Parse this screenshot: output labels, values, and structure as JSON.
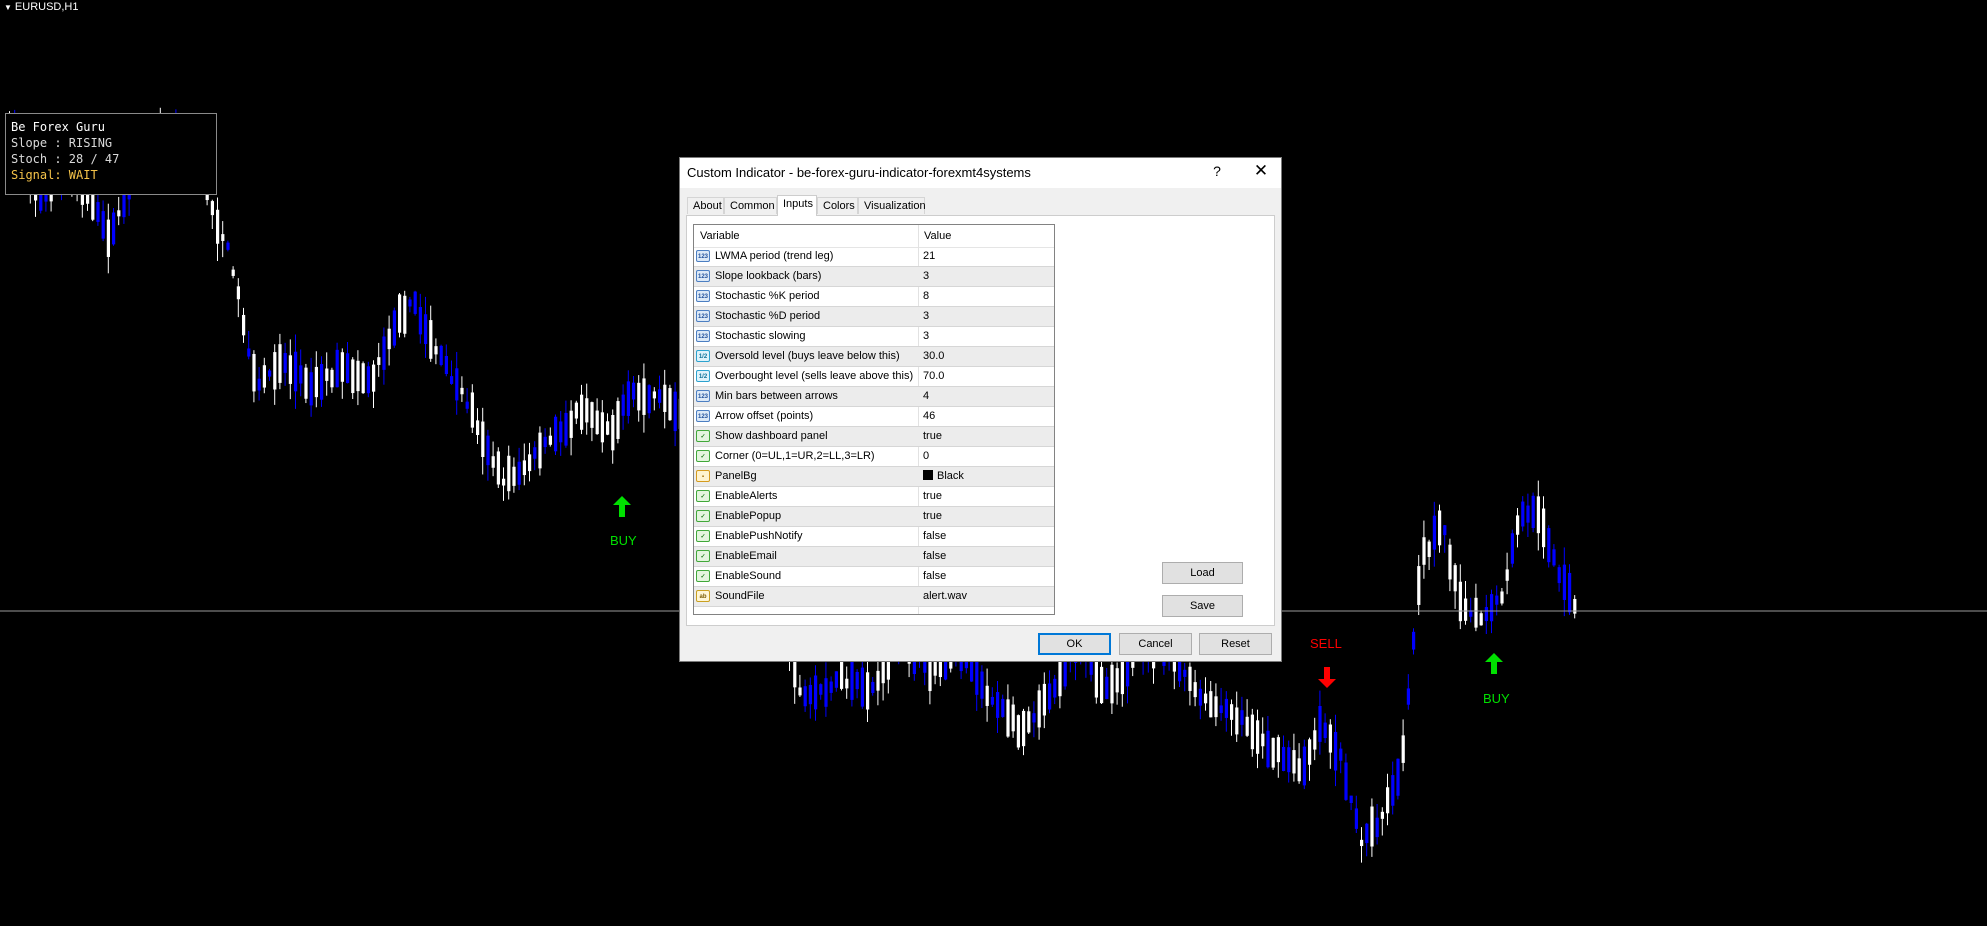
{
  "chart": {
    "symbol": "EURUSD,H1",
    "background": "#000000",
    "bull_color": "#ffffff",
    "bear_color": "#0000ff",
    "buy_color": "#00e000",
    "sell_color": "#ff0000"
  },
  "dashboard": {
    "title": "Be Forex Guru",
    "slope": "Slope : RISING",
    "stoch": "Stoch : 28 / 47",
    "signal": "Signal: WAIT"
  },
  "signals": {
    "buy1": "BUY",
    "buy2": "BUY",
    "sell1": "SELL"
  },
  "dialog": {
    "title": "Custom Indicator - be-forex-guru-indicator-forexmt4systems",
    "help": "?",
    "close": "✕",
    "tabs": [
      "About",
      "Common",
      "Inputs",
      "Colors",
      "Visualization"
    ],
    "active_tab": "Inputs",
    "columns": {
      "variable": "Variable",
      "value": "Value"
    },
    "inputs": [
      {
        "icon": "123",
        "name": "LWMA period (trend leg)",
        "value": "21"
      },
      {
        "icon": "123",
        "name": "Slope lookback (bars)",
        "value": "3"
      },
      {
        "icon": "123",
        "name": "Stochastic %K period",
        "value": "8"
      },
      {
        "icon": "123",
        "name": "Stochastic %D period",
        "value": "3"
      },
      {
        "icon": "123",
        "name": "Stochastic slowing",
        "value": "3"
      },
      {
        "icon": "val",
        "name": "Oversold level (buys leave below this)",
        "value": "30.0"
      },
      {
        "icon": "val",
        "name": "Overbought level (sells leave above this)",
        "value": "70.0"
      },
      {
        "icon": "123",
        "name": "Min bars between arrows",
        "value": "4"
      },
      {
        "icon": "123",
        "name": "Arrow offset (points)",
        "value": "46"
      },
      {
        "icon": "bool",
        "name": "Show dashboard panel",
        "value": "true"
      },
      {
        "icon": "bool",
        "name": "Corner (0=UL,1=UR,2=LL,3=LR)",
        "value": "0"
      },
      {
        "icon": "clr",
        "name": "PanelBg",
        "value": "Black"
      },
      {
        "icon": "bool",
        "name": "EnableAlerts",
        "value": "true"
      },
      {
        "icon": "bool",
        "name": "EnablePopup",
        "value": "true"
      },
      {
        "icon": "bool",
        "name": "EnablePushNotify",
        "value": "false"
      },
      {
        "icon": "bool",
        "name": "EnableEmail",
        "value": "false"
      },
      {
        "icon": "bool",
        "name": "EnableSound",
        "value": "false"
      },
      {
        "icon": "str",
        "name": "SoundFile",
        "value": "alert.wav"
      }
    ],
    "buttons": {
      "load": "Load",
      "save": "Save",
      "ok": "OK",
      "cancel": "Cancel",
      "reset": "Reset"
    }
  }
}
